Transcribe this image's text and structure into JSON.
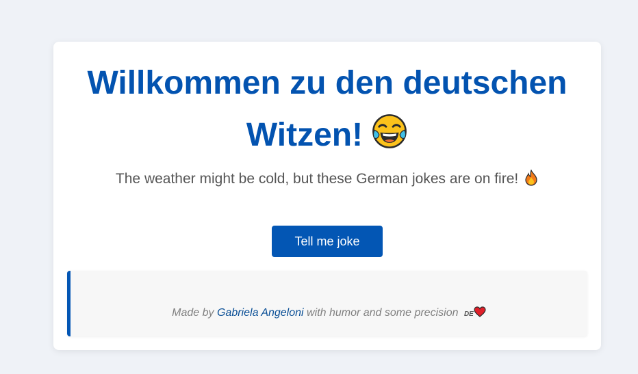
{
  "header": {
    "title_line1": "Willkommen zu den deutschen",
    "title_line2": "Witzen!",
    "title_emoji": "laughing-tears-icon",
    "subtitle": "The weather might be cold, but these German jokes are on fire!",
    "subtitle_emoji": "fire-icon"
  },
  "actions": {
    "joke_button_label": "Tell me joke"
  },
  "joke_panel": {
    "joke_text": ""
  },
  "footer": {
    "made_by": "Made by",
    "author": "Gabriela Angeloni",
    "suffix": "with humor and some precision",
    "flag_code": "DE",
    "heart_emoji": "heart-icon"
  },
  "colors": {
    "accent": "#0356b4",
    "title": "#0353b0",
    "background": "#eff2f7"
  }
}
